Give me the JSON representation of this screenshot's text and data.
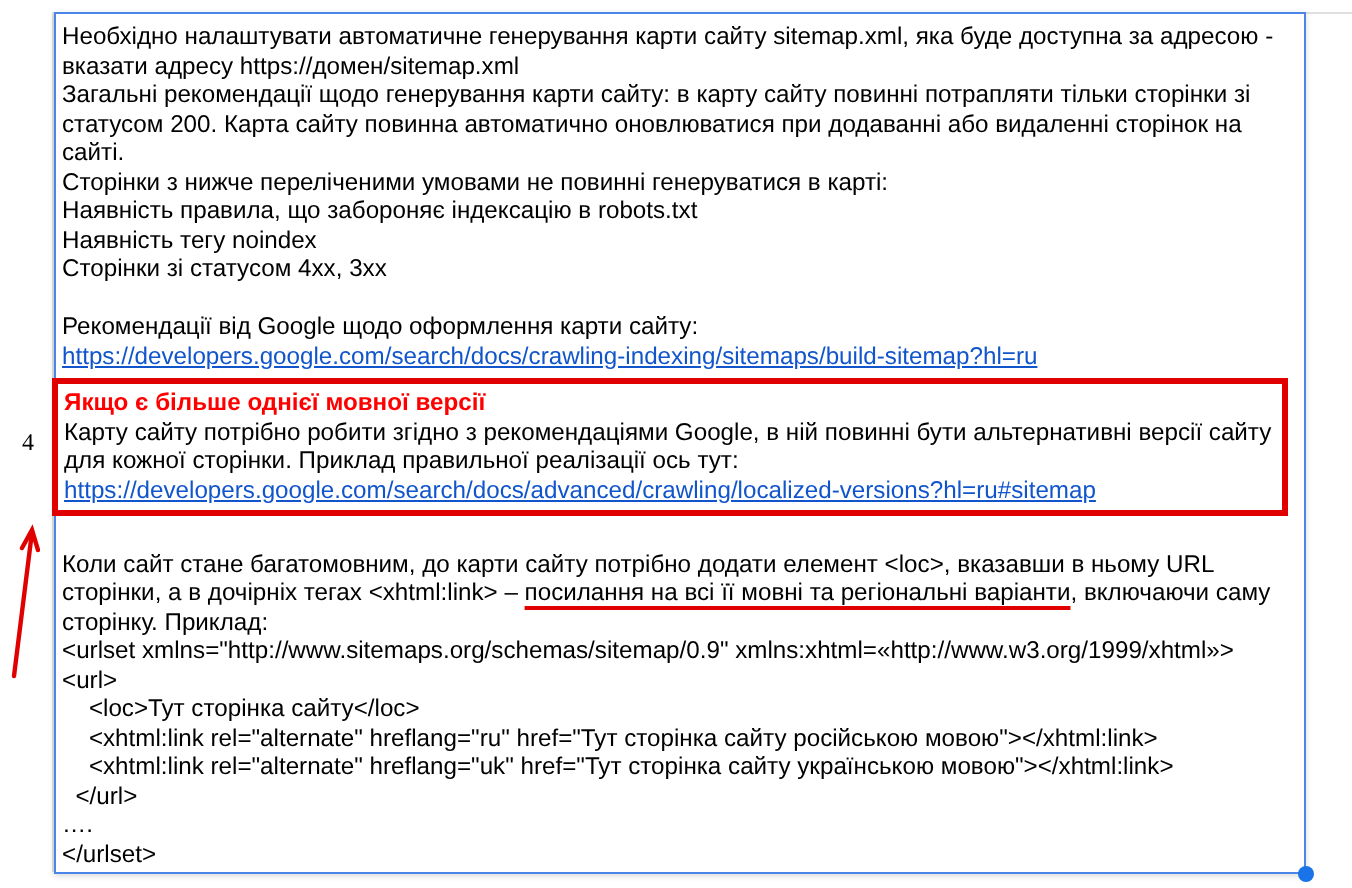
{
  "row_number": "4",
  "pointer_arrow": true,
  "sections": [
    {
      "boxed": false,
      "lines": [
        {
          "kind": "text",
          "text": "Необхідно налаштувати автоматичне генерування карти сайту sitemap.xml, яка буде доступна за адресою -"
        },
        {
          "kind": "text",
          "text": "вказати адресу https://домен/sitemap.xml"
        },
        {
          "kind": "text",
          "text": "Загальні рекомендації щодо генерування карти сайту: в карту сайту повинні потрапляти тільки сторінки зі"
        },
        {
          "kind": "text",
          "text": "статусом 200. Карта сайту повинна автоматично оновлюватися при додаванні або видаленні сторінок на"
        },
        {
          "kind": "text",
          "text": "сайті."
        },
        {
          "kind": "text",
          "text": "Сторінки з нижче переліченими умовами не повинні генеруватися в карті:"
        },
        {
          "kind": "text",
          "text": "Наявність правила, що забороняє індексацію в robots.txt"
        },
        {
          "kind": "text",
          "text": "Наявність тегу noindex"
        },
        {
          "kind": "text",
          "text": "Сторінки зі статусом 4хх, 3хх"
        },
        {
          "kind": "blank"
        },
        {
          "kind": "text",
          "text": "Рекомендації від Google щодо оформлення карти сайту:"
        },
        {
          "kind": "link",
          "text": "https://developers.google.com/search/docs/crawling-indexing/sitemaps/build-sitemap?hl=ru"
        }
      ]
    },
    {
      "boxed": true,
      "lines": [
        {
          "kind": "heading",
          "text": "Якщо є більше однієї мовної версії"
        },
        {
          "kind": "text",
          "text": "Карту сайту потрібно робити згідно з рекомендаціями Google, в ній повинні бути альтернативні версії сайту"
        },
        {
          "kind": "text",
          "text": "для кожної сторінки. Приклад правильної реалізації ось тут:"
        },
        {
          "kind": "link",
          "text": "https://developers.google.com/search/docs/advanced/crawling/localized-versions?hl=ru#sitemap"
        }
      ]
    },
    {
      "boxed": false,
      "lines": [
        {
          "kind": "blank"
        },
        {
          "kind": "text",
          "text": "Коли сайт стане багатомовним, до карти сайту потрібно додати елемент <loc>, вказавши в ньому URL"
        },
        {
          "kind": "segmented",
          "segments": [
            {
              "text": "сторінки, а в дочірніх тегах <xhtml:link> – ",
              "underlined": false
            },
            {
              "text": "посилання на всі її мовні та регіональні варіанти",
              "underlined": true
            },
            {
              "text": ", включаючи саму",
              "underlined": false
            }
          ]
        },
        {
          "kind": "text",
          "text": "сторінку. Приклад:"
        },
        {
          "kind": "text",
          "text": "<urlset xmlns=\"http://www.sitemaps.org/schemas/sitemap/0.9\" xmlns:xhtml=«http://www.w3.org/1999/xhtml»>"
        },
        {
          "kind": "text",
          "text": "<url>"
        },
        {
          "kind": "text",
          "text": "    <loc>Тут сторінка сайту</loc>"
        },
        {
          "kind": "text",
          "text": "    <xhtml:link rel=\"alternate\" hreflang=\"ru\" href=\"Тут сторінка сайту російською мовою\"></xhtml:link>"
        },
        {
          "kind": "text",
          "text": "    <xhtml:link rel=\"alternate\" hreflang=\"uk\" href=\"Тут сторінка сайту українською мовою\"></xhtml:link>"
        },
        {
          "kind": "text",
          "text": "  </url>"
        },
        {
          "kind": "text",
          "text": "…."
        },
        {
          "kind": "text",
          "text": "</urlset>"
        }
      ]
    }
  ]
}
